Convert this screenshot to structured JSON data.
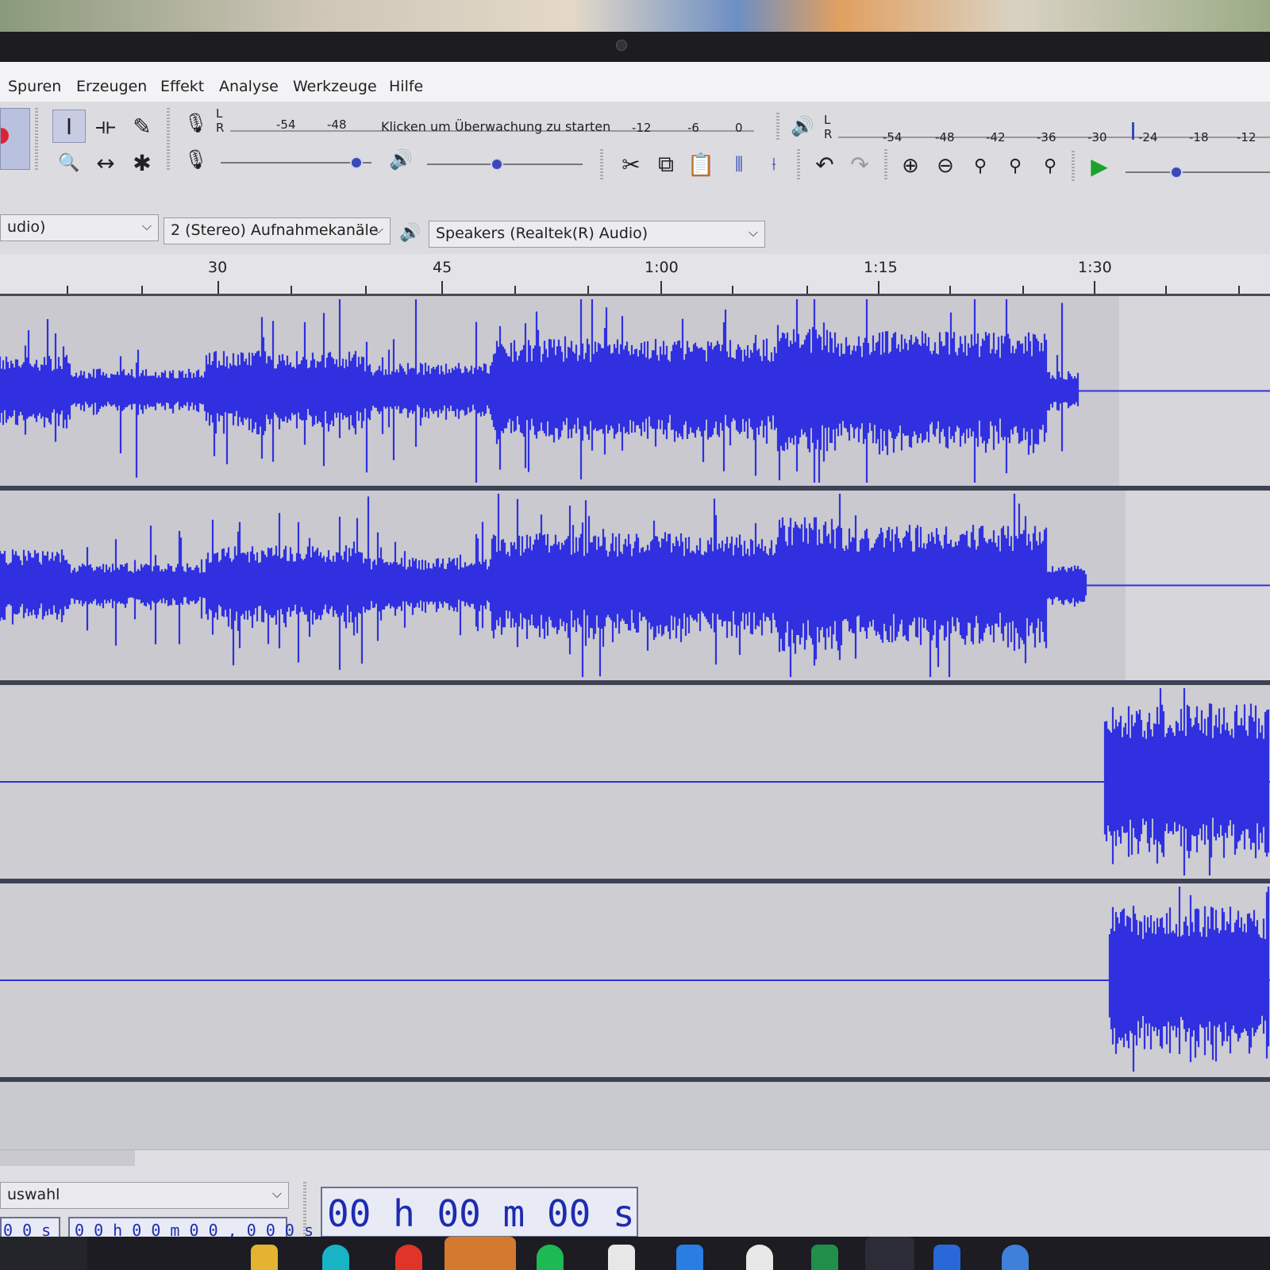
{
  "menu": [
    "Spuren",
    "Erzeugen",
    "Effekt",
    "Analyse",
    "Werkzeuge",
    "Hilfe"
  ],
  "toolbar": {
    "tools": [
      {
        "name": "selection-tool",
        "glyph": "I"
      },
      {
        "name": "envelope-tool",
        "glyph": "⟛"
      },
      {
        "name": "draw-tool",
        "glyph": "✎"
      },
      {
        "name": "zoom-tool",
        "glyph": "🔍"
      },
      {
        "name": "time-shift-tool",
        "glyph": "↔"
      },
      {
        "name": "multi-tool",
        "glyph": "✱"
      }
    ],
    "record_meter": {
      "lr": "L\nR",
      "ticks": [
        "-54",
        "-48",
        "-12",
        "-6",
        "0"
      ],
      "prompt": "Klicken um Überwachung zu starten"
    },
    "play_meter": {
      "lr": "L\nR",
      "ticks": [
        "-54",
        "-48",
        "-42",
        "-36",
        "-30",
        "-24",
        "-18",
        "-12"
      ]
    },
    "recording_volume": 0.9,
    "playback_volume": 0.45,
    "playback_speed": 0.35
  },
  "devices": {
    "host_fragment": "udio)",
    "channels": "2 (Stereo) Aufnahmekanäle",
    "output": "Speakers (Realtek(R) Audio)"
  },
  "ruler": [
    "30",
    "45",
    "1:00",
    "1:15",
    "1:30"
  ],
  "status": {
    "snap_fragment": "uswahl",
    "small_time_fragment": "0 0 s",
    "selection_time": "0 0 h 0 0 m 0 0 , 0 0 0 s",
    "audio_position": "00 h 00 m 00 s"
  },
  "colors": {
    "waveform": "#3030e0",
    "track_bg": "#c9c9cf",
    "selected_region": "#b9b9bf",
    "accent": "#2a2fd4"
  }
}
